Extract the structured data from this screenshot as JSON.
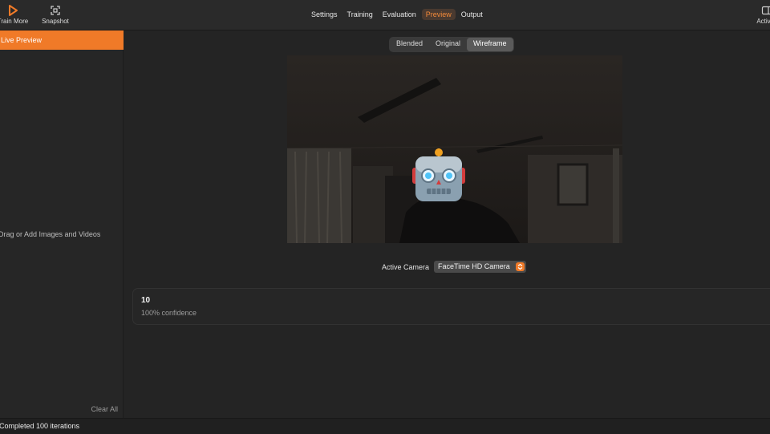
{
  "toolbar": {
    "train_label": "Train More",
    "snapshot_label": "Snapshot",
    "activity_label": "Activity",
    "tabs": [
      {
        "label": "Settings"
      },
      {
        "label": "Training"
      },
      {
        "label": "Evaluation"
      },
      {
        "label": "Preview"
      },
      {
        "label": "Output"
      }
    ],
    "active_tab": "Preview"
  },
  "sidebar": {
    "live_preview_label": "Live Preview",
    "drop_hint": "Drag or Add Images and Videos",
    "clear_all_label": "Clear All"
  },
  "preview": {
    "modes": [
      "Blended",
      "Original",
      "Wireframe"
    ],
    "selected_mode": "Wireframe",
    "overlay_icon": "robot-face-emoji"
  },
  "camera": {
    "label": "Active Camera",
    "selected": "FaceTime HD Camera"
  },
  "result": {
    "class_label": "10",
    "confidence": "100% confidence"
  },
  "status": {
    "text": "Completed 100 iterations"
  },
  "colors": {
    "accent": "#f07a28",
    "background": "#242424",
    "panel": "#262626"
  }
}
